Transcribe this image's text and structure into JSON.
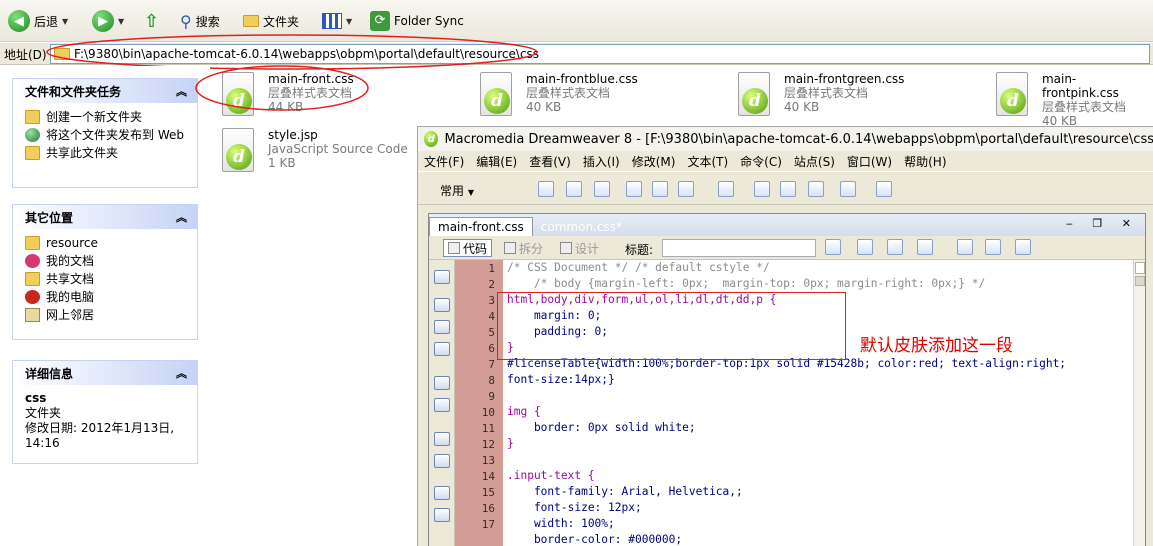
{
  "toolbar": {
    "back": "后退",
    "search": "搜索",
    "folders": "文件夹",
    "folder_sync": "Folder Sync"
  },
  "address": {
    "label": "地址(D)",
    "path": "F:\\9380\\bin\\apache-tomcat-6.0.14\\webapps\\obpm\\portal\\default\\resource\\css"
  },
  "tasks": {
    "title": "文件和文件夹任务",
    "items": [
      "创建一个新文件夹",
      "将这个文件夹发布到 Web",
      "共享此文件夹"
    ]
  },
  "places": {
    "title": "其它位置",
    "items": [
      "resource",
      "我的文档",
      "共享文档",
      "我的电脑",
      "网上邻居"
    ]
  },
  "details": {
    "title": "详细信息",
    "name": "css",
    "type": "文件夹",
    "modified": "修改日期: 2012年1月13日, 14:16"
  },
  "files": [
    {
      "name": "main-front.css",
      "type": "层叠样式表文档",
      "size": "44 KB"
    },
    {
      "name": "main-frontblue.css",
      "type": "层叠样式表文档",
      "size": "40 KB"
    },
    {
      "name": "main-frontgreen.css",
      "type": "层叠样式表文档",
      "size": "40 KB"
    },
    {
      "name": "main-frontpink.css",
      "type": "层叠样式表文档",
      "size": "40 KB"
    },
    {
      "name": "style.jsp",
      "type": "JavaScript Source Code",
      "size": "1 KB"
    }
  ],
  "dreamweaver": {
    "title": "Macromedia Dreamweaver 8 - [F:\\9380\\bin\\apache-tomcat-6.0.14\\webapps\\obpm\\portal\\default\\resource\\css",
    "menu": [
      "文件(F)",
      "编辑(E)",
      "查看(V)",
      "插入(I)",
      "修改(M)",
      "文本(T)",
      "命令(C)",
      "站点(S)",
      "窗口(W)",
      "帮助(H)"
    ],
    "insert_category": "常用",
    "tabs": [
      "main-front.css",
      "common.css*"
    ],
    "view_code": "代码",
    "view_split": "拆分",
    "view_design": "设计",
    "title_label": "标题:",
    "line_numbers": [
      "1",
      "2",
      "3",
      "4",
      "5",
      "6",
      "7",
      "8",
      "9",
      "10",
      "11",
      "12",
      "13",
      "14",
      "15",
      "16",
      "17"
    ],
    "code_lines": [
      {
        "text": "/* CSS Document */ /* default cstyle */",
        "color": "#8c8c8c"
      },
      {
        "text": "    /* body {margin-left: 0px;  margin-top: 0px; margin-right: 0px;} */",
        "color": "#8c8c8c"
      },
      {
        "text": "html,body,div,form,ul,ol,li,dl,dt,dd,p {",
        "color": "#9b0a9b"
      },
      {
        "text": "    margin: 0;",
        "color": "#000080"
      },
      {
        "text": "    padding: 0;",
        "color": "#000080"
      },
      {
        "text": "}",
        "color": "#9b0a9b"
      },
      {
        "text": "#licenseTable{width:100%;border-top:1px solid #15428b; color:red; text-align:right;",
        "color": "#000080"
      },
      {
        "text": "font-size:14px;}",
        "color": "#000080"
      },
      {
        "text": "",
        "color": "#000080"
      },
      {
        "text": "img {",
        "color": "#9b0a9b"
      },
      {
        "text": "    border: 0px solid white;",
        "color": "#000080"
      },
      {
        "text": "}",
        "color": "#9b0a9b"
      },
      {
        "text": "",
        "color": "#000080"
      },
      {
        "text": ".input-text {",
        "color": "#9b0a9b"
      },
      {
        "text": "    font-family: Arial, Helvetica,;",
        "color": "#000080"
      },
      {
        "text": "    font-size: 12px;",
        "color": "#000080"
      },
      {
        "text": "    width: 100%;",
        "color": "#000080"
      },
      {
        "text": "    border-color: #000000;",
        "color": "#000080"
      }
    ]
  },
  "annotation": "默认皮肤添加这一段",
  "colors": {
    "annotation_red": "#e00000",
    "gutter": "#d39d95",
    "highlight_box": "#e02020"
  }
}
